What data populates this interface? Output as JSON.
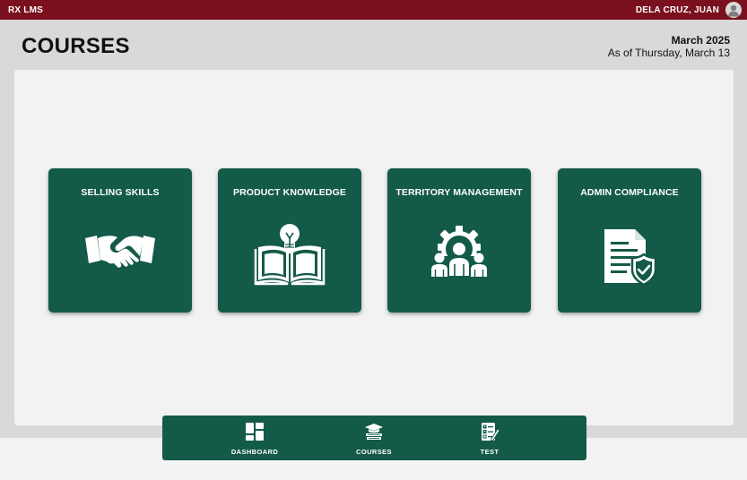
{
  "topbar": {
    "app_name": "RX LMS",
    "user_name": "DELA CRUZ, JUAN",
    "avatar_icon": "user-avatar-icon"
  },
  "header": {
    "title": "COURSES",
    "month": "March 2025",
    "as_of": "As of Thursday, March 13"
  },
  "courses": [
    {
      "label": "SELLING SKILLS",
      "icon": "handshake-icon"
    },
    {
      "label": "PRODUCT KNOWLEDGE",
      "icon": "book-lightbulb-icon"
    },
    {
      "label": "TERRITORY MANAGEMENT",
      "icon": "team-gear-icon"
    },
    {
      "label": "ADMIN COMPLIANCE",
      "icon": "document-shield-icon"
    }
  ],
  "nav": [
    {
      "label": "DASHBOARD",
      "icon": "dashboard-icon"
    },
    {
      "label": "COURSES",
      "icon": "courses-icon"
    },
    {
      "label": "TEST",
      "icon": "test-checklist-icon"
    }
  ],
  "colors": {
    "topbar": "#7a0f1e",
    "card": "#145a48",
    "page_bg": "#d9d9d9",
    "panel_bg": "#f2f2f2"
  }
}
